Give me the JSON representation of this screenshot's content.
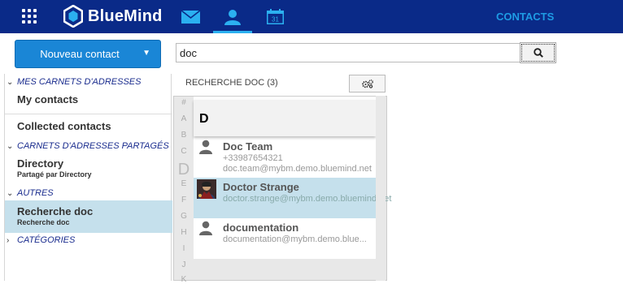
{
  "header": {
    "brand": "BlueMind",
    "section_title": "CONTACTS",
    "calendar_day": "31",
    "colors": {
      "bar": "#0a2a88",
      "accent": "#2bb0f0"
    }
  },
  "toolbar": {
    "new_contact_label": "Nouveau contact",
    "search_value": "doc"
  },
  "sidebar": {
    "my_address_books": "MES CARNETS D'ADRESSES",
    "my_contacts": "My contacts",
    "collected_contacts": "Collected contacts",
    "shared_address_books": "CARNETS D'ADRESSES PARTAGÉS",
    "directory": {
      "name": "Directory",
      "sub": "Partagé par Directory"
    },
    "others": "AUTRES",
    "search_doc": {
      "name": "Recherche doc",
      "sub": "Recherche doc"
    },
    "categories": "CATÉGORIES"
  },
  "list": {
    "header": "RECHERCHE DOC (3)",
    "group_letter": "D",
    "alphabet": [
      "#",
      "A",
      "B",
      "C",
      "D",
      "E",
      "F",
      "G",
      "H",
      "I",
      "J",
      "K"
    ],
    "contacts": [
      {
        "name": "Doc Team",
        "line2": "+33987654321",
        "line3": "doc.team@mybm.demo.bluemind.net"
      },
      {
        "name": "Doctor Strange",
        "line2": "doctor.strange@mybm.demo.bluemind.net"
      },
      {
        "name": "documentation",
        "line2": "documentation@mybm.demo.blue..."
      }
    ]
  }
}
